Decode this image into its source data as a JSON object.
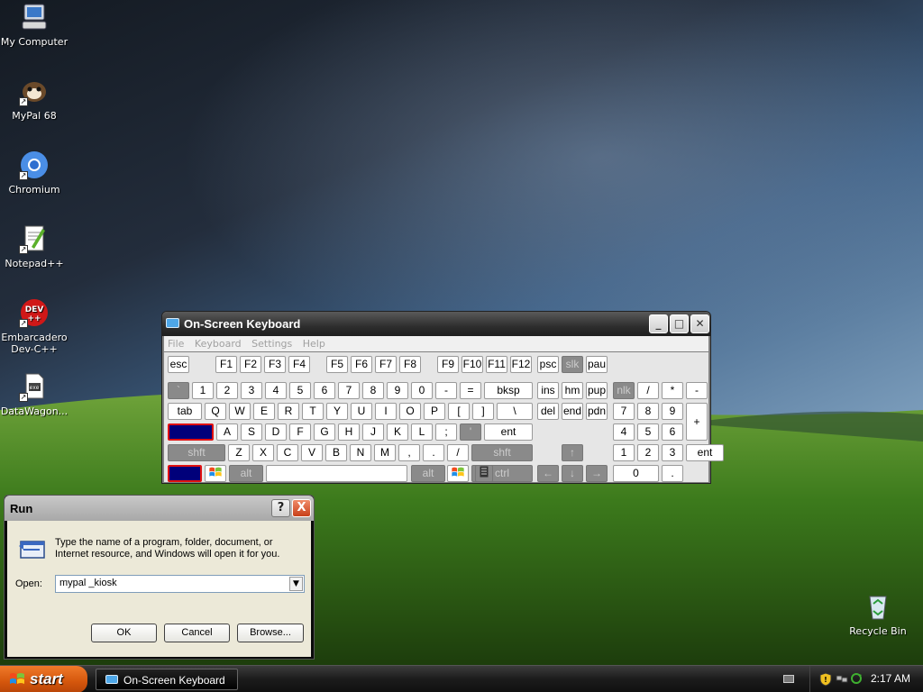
{
  "desktop_icons": [
    {
      "label": "My Computer",
      "icon": "my-computer-icon"
    },
    {
      "label": "MyPal 68",
      "icon": "mypal-icon"
    },
    {
      "label": "Chromium",
      "icon": "chromium-icon"
    },
    {
      "label": "Notepad++",
      "icon": "notepadpp-icon"
    },
    {
      "label": "Embarcadero Dev-C++",
      "icon": "devcpp-icon"
    },
    {
      "label": "DataWagon...",
      "icon": "datawagon-icon"
    },
    {
      "label": "Recycle Bin",
      "icon": "recycle-bin-icon"
    }
  ],
  "osk": {
    "title": "On-Screen Keyboard",
    "menu": [
      "File",
      "Keyboard",
      "Settings",
      "Help"
    ],
    "keys": [
      "esc",
      "F1",
      "F2",
      "F3",
      "F4",
      "F5",
      "F6",
      "F7",
      "F8",
      "F9",
      "F10",
      "F11",
      "F12",
      "psc",
      "slk",
      "pau",
      "`",
      "1",
      "2",
      "3",
      "4",
      "5",
      "6",
      "7",
      "8",
      "9",
      "0",
      "-",
      "=",
      "bksp",
      "ins",
      "hm",
      "pup",
      "nlk",
      "/",
      "*",
      "-",
      "tab",
      "Q",
      "W",
      "E",
      "R",
      "T",
      "Y",
      "U",
      "I",
      "O",
      "P",
      "[",
      "]",
      "\\",
      "del",
      "end",
      "pdn",
      "7",
      "8",
      "9",
      "+",
      "lock",
      "A",
      "S",
      "D",
      "F",
      "G",
      "H",
      "J",
      "K",
      "L",
      ";",
      "'",
      "ent",
      "4",
      "5",
      "6",
      "shft",
      "Z",
      "X",
      "C",
      "V",
      "B",
      "N",
      "M",
      ",",
      ".",
      "/",
      "shft",
      "↑",
      "1",
      "2",
      "3",
      "ent",
      "ctrl",
      "alt",
      "",
      "alt",
      "ctrl",
      "←",
      "↓",
      "→",
      "0",
      "."
    ]
  },
  "run": {
    "title": "Run",
    "help": "?",
    "close": "X",
    "description": "Type the name of a program, folder, document, or Internet resource, and Windows will open it for you.",
    "open_label": "Open:",
    "open_value": "mypal _kiosk",
    "ok": "OK",
    "cancel": "Cancel",
    "browse": "Browse..."
  },
  "taskbar": {
    "start": "start",
    "task_item": "On-Screen Keyboard",
    "clock": "2:17 AM"
  },
  "colors": {
    "accent": "#d4560c",
    "selected_key": "#00007a"
  }
}
